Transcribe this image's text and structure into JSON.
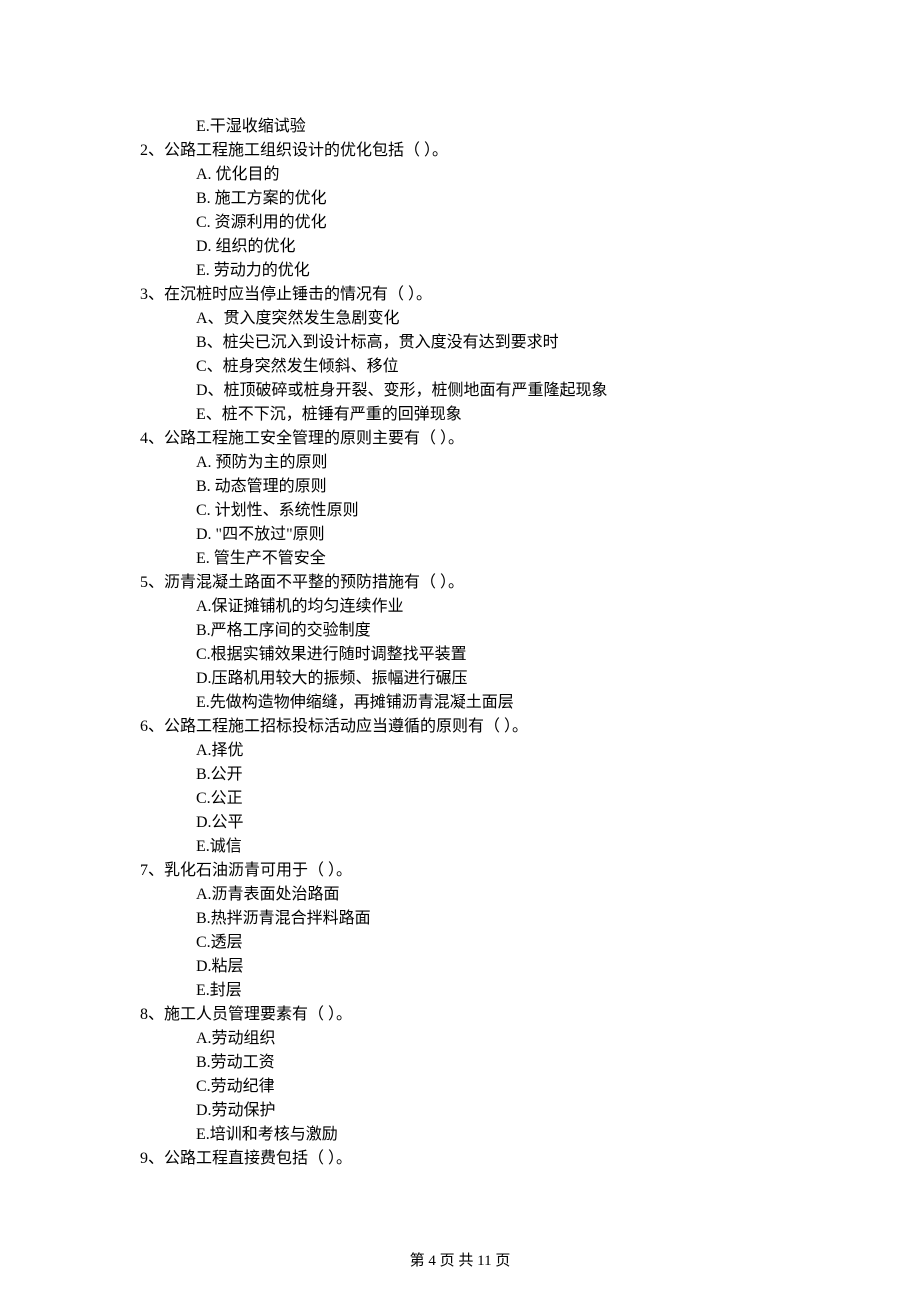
{
  "prev_opt": "E.干湿收缩试验",
  "questions": [
    {
      "num": "2、",
      "stem": "公路工程施工组织设计的优化包括（    ）。",
      "options": [
        "A.  优化目的",
        "B.  施工方案的优化",
        "C.  资源利用的优化",
        "D.  组织的优化",
        "E.  劳动力的优化"
      ]
    },
    {
      "num": "3、",
      "stem": "在沉桩时应当停止锤击的情况有（    ）。",
      "options": [
        "A、贯入度突然发生急剧变化",
        "B、桩尖已沉入到设计标高，贯入度没有达到要求时",
        "C、桩身突然发生倾斜、移位",
        "D、桩顶破碎或桩身开裂、变形，桩侧地面有严重隆起现象",
        "E、桩不下沉，桩锤有严重的回弹现象"
      ]
    },
    {
      "num": "4、",
      "stem": "公路工程施工安全管理的原则主要有（    ）。",
      "options": [
        "A.  预防为主的原则",
        "B.  动态管理的原则",
        "C.  计划性、系统性原则",
        "D.  \"四不放过\"原则",
        "E.  管生产不管安全"
      ]
    },
    {
      "num": "5、",
      "stem": "沥青混凝土路面不平整的预防措施有（    ）。",
      "options": [
        "A.保证摊铺机的均匀连续作业",
        "B.严格工序间的交验制度",
        "C.根据实铺效果进行随时调整找平装置",
        "D.压路机用较大的振频、振幅进行碾压",
        "E.先做构造物伸缩缝，再摊铺沥青混凝土面层"
      ]
    },
    {
      "num": "6、",
      "stem": "公路工程施工招标投标活动应当遵循的原则有（    ）。",
      "options": [
        "A.择优",
        "B.公开",
        "C.公正",
        "D.公平",
        "E.诚信"
      ]
    },
    {
      "num": "7、",
      "stem": "乳化石油沥青可用于（    ）。",
      "options": [
        "A.沥青表面处治路面",
        "B.热拌沥青混合拌料路面",
        "C.透层",
        "D.粘层",
        "E.封层"
      ]
    },
    {
      "num": "8、",
      "stem": "施工人员管理要素有（    ）。",
      "options": [
        "A.劳动组织",
        "B.劳动工资",
        "C.劳动纪律",
        "D.劳动保护",
        "E.培训和考核与激励"
      ]
    },
    {
      "num": "9、",
      "stem": "公路工程直接费包括（    ）。",
      "options": []
    }
  ],
  "footer": "第 4 页 共 11 页"
}
